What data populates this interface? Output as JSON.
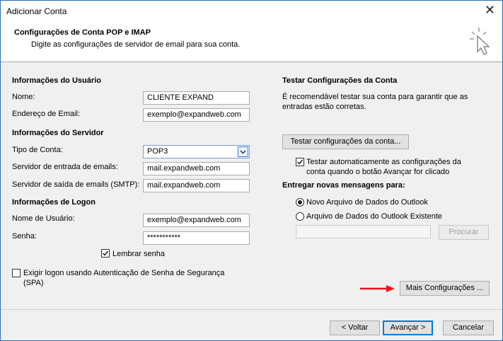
{
  "window": {
    "title": "Adicionar Conta",
    "close_label": "✕"
  },
  "header": {
    "title": "Configurações de Conta POP e IMAP",
    "subtitle": "Digite as configurações de servidor de email para sua conta."
  },
  "user_info": {
    "heading": "Informações do Usuário",
    "name_label": "Nome:",
    "name_value": "CLIENTE EXPAND",
    "email_label": "Endereço de Email:",
    "email_value": "exemplo@expandweb.com"
  },
  "server_info": {
    "heading": "Informações do Servidor",
    "account_type_label": "Tipo de Conta:",
    "account_type_value": "POP3",
    "incoming_label": "Servidor de entrada de emails:",
    "incoming_value": "mail.expandweb.com",
    "outgoing_label": "Servidor de saída de emails (SMTP):",
    "outgoing_value": "mail.expandweb.com"
  },
  "logon_info": {
    "heading": "Informações de Logon",
    "username_label": "Nome de Usuário:",
    "username_value": "exemplo@expandweb.com",
    "password_label": "Senha:",
    "password_value": "***********",
    "remember_label": "Lembrar senha",
    "remember_checked": true,
    "spa_label_line1": "Exigir logon usando Autenticação de Senha de Segurança",
    "spa_label_line2": "(SPA)",
    "spa_checked": false
  },
  "test_settings": {
    "heading": "Testar Configurações da Conta",
    "description_line1": "É recomendável testar sua conta para garantir que as",
    "description_line2": "entradas estão corretas.",
    "test_button": "Testar configurações da conta...",
    "auto_test_line1": "Testar automaticamente as configurações da",
    "auto_test_line2": "conta quando o botão Avançar for clicado",
    "auto_test_checked": true
  },
  "deliver": {
    "heading": "Entregar novas mensagens para:",
    "option_new": "Novo Arquivo de Dados do Outlook",
    "option_existing": "Arquivo de Dados do Outlook Existente",
    "selected": "new",
    "path_value": "",
    "browse_button": "Procurar"
  },
  "more_settings_button": "Mais Configurações ...",
  "footer": {
    "back_button": "< Voltar",
    "next_button": "Avançar >",
    "cancel_button": "Cancelar"
  },
  "colors": {
    "arrow": "#e8141a",
    "accent": "#0078d7"
  },
  "icons": {
    "header_icon": "cursor-click-icon",
    "close": "close-icon",
    "dropdown": "chevron-down-icon"
  }
}
